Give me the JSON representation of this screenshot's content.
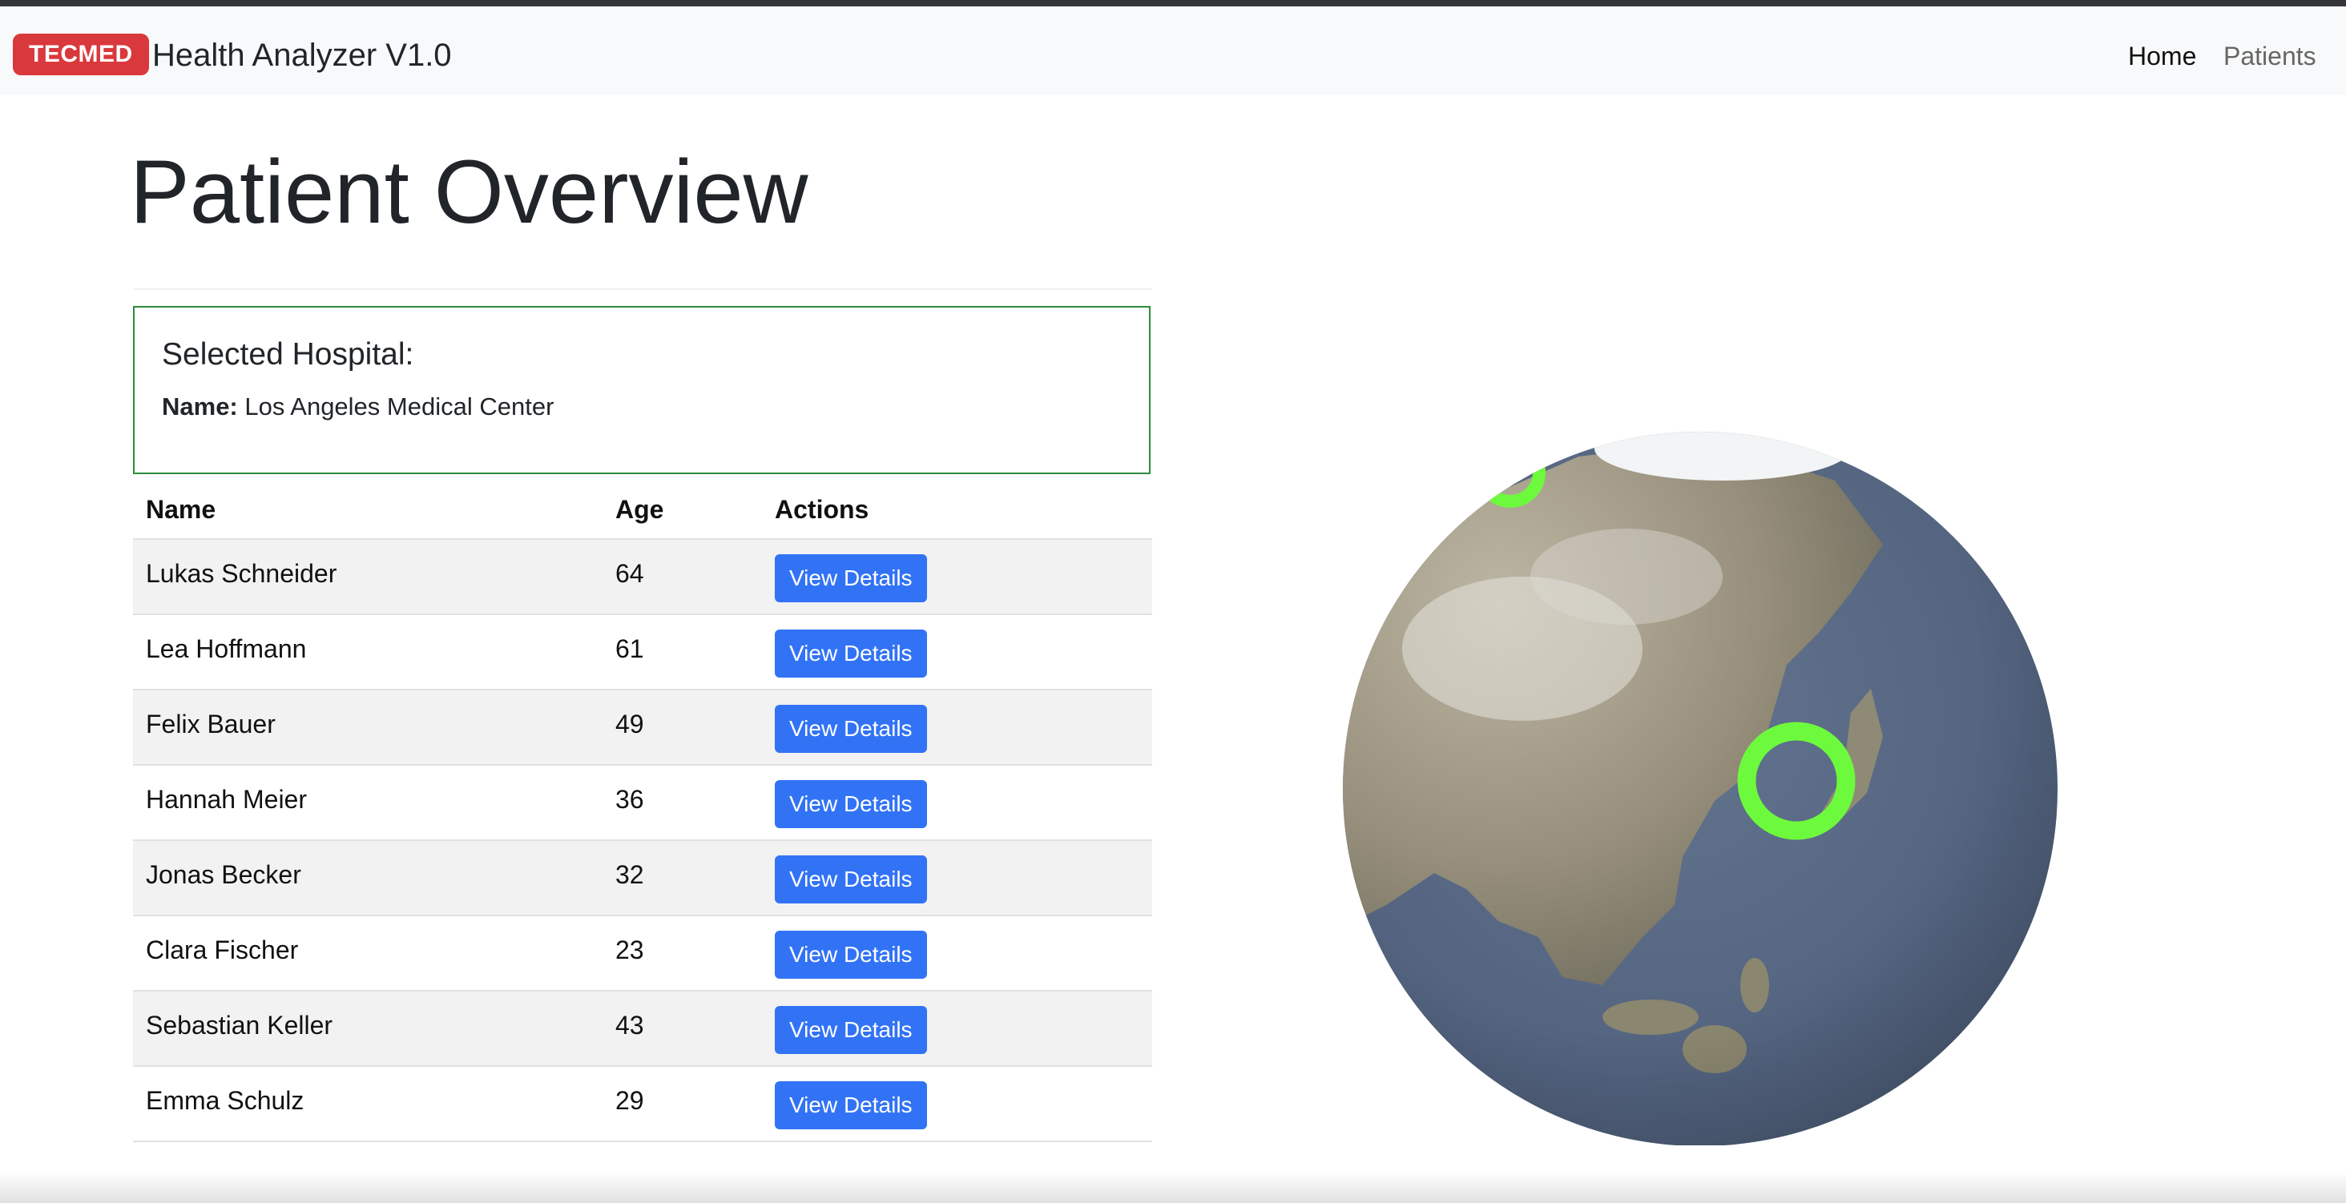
{
  "navbar": {
    "brand_badge": "TECMED",
    "brand_title": "Health Analyzer V1.0",
    "links": [
      {
        "label": "Home",
        "active": true
      },
      {
        "label": "Patients",
        "active": false
      }
    ]
  },
  "page": {
    "title": "Patient Overview"
  },
  "hospital": {
    "heading": "Selected Hospital:",
    "name_label": "Name:",
    "name_value": "Los Angeles Medical Center"
  },
  "table": {
    "headers": [
      "Name",
      "Age",
      "Actions"
    ],
    "rows": [
      {
        "name": "Lukas Schneider",
        "age": "64",
        "action": "View Details"
      },
      {
        "name": "Lea Hoffmann",
        "age": "61",
        "action": "View Details"
      },
      {
        "name": "Felix Bauer",
        "age": "49",
        "action": "View Details"
      },
      {
        "name": "Hannah Meier",
        "age": "36",
        "action": "View Details"
      },
      {
        "name": "Jonas Becker",
        "age": "32",
        "action": "View Details"
      },
      {
        "name": "Clara Fischer",
        "age": "23",
        "action": "View Details"
      },
      {
        "name": "Sebastian Keller",
        "age": "43",
        "action": "View Details"
      },
      {
        "name": "Emma Schulz",
        "age": "29",
        "action": "View Details"
      }
    ]
  },
  "globe": {
    "marker_color": "#6dfa3c",
    "ocean_color": "#5a6a86",
    "land_color": "#a89f8c"
  },
  "colors": {
    "badge": "#d9383d",
    "button": "#3273f6",
    "card_border": "#2e8b3c"
  }
}
